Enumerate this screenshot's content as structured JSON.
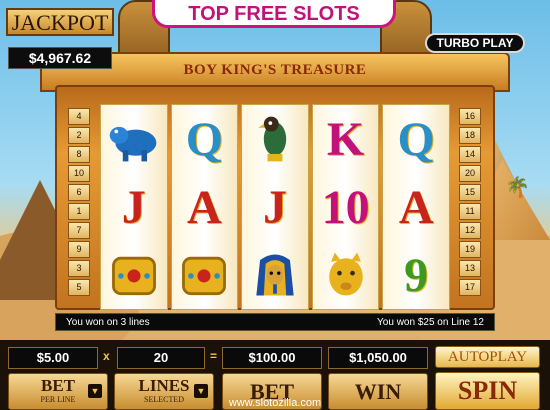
{
  "banner": "TOP FREE SLOTS",
  "jackpot": {
    "label": "JACKPOT",
    "value": "$4,967.62"
  },
  "turbo_label": "TURBO PLAY",
  "game_title": "BOY KING'S TREASURE",
  "paylines_left": [
    "4",
    "2",
    "8",
    "10",
    "6",
    "1",
    "7",
    "9",
    "3",
    "5"
  ],
  "paylines_right": [
    "16",
    "18",
    "14",
    "20",
    "15",
    "11",
    "12",
    "19",
    "13",
    "17"
  ],
  "reels": [
    [
      "hippo-symbol",
      "J",
      "bracelet-symbol"
    ],
    [
      "Q",
      "A",
      "bracelet-symbol"
    ],
    [
      "falcon-symbol",
      "J",
      "pharaoh-mask-symbol"
    ],
    [
      "K",
      "10",
      "lioness-symbol"
    ],
    [
      "Q",
      "A",
      "9"
    ]
  ],
  "messages": {
    "left": "You won on 3 lines",
    "right": "You won $25 on Line 12"
  },
  "controls": {
    "bet_per_line": "$5.00",
    "multiply_sign": "x",
    "lines": "20",
    "equals_sign": "=",
    "total_bet": "$100.00",
    "win": "$1,050.00",
    "bet_per_line_label": "BET",
    "bet_per_line_sub": "PER LINE",
    "lines_label": "LINES",
    "lines_sub": "SELECTED",
    "bet_label": "BET",
    "win_label": "WIN",
    "autoplay_label": "AUTOPLAY",
    "spin_label": "SPIN"
  },
  "website": "www.slotozilla.com",
  "colors": {
    "banner_pink": "#c2127a",
    "frame_gold": "#e69a35",
    "letter_red": "#c8231d",
    "letter_blue": "#2a8fc6",
    "letter_pink": "#c2127a",
    "letter_green": "#3c9a22"
  }
}
